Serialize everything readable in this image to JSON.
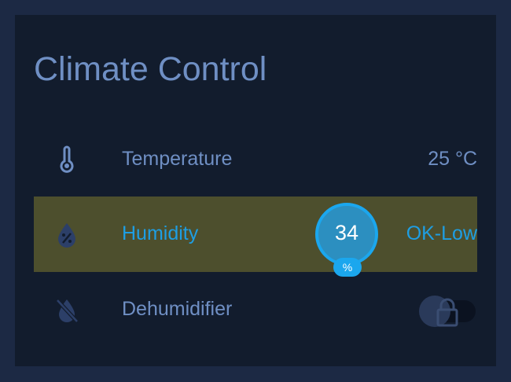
{
  "card": {
    "title": "Climate Control",
    "rows": [
      {
        "label": "Temperature",
        "value": "25 °C",
        "icon": "thermometer-icon"
      },
      {
        "label": "Humidity",
        "value": "OK-Low",
        "icon": "water-percent-icon",
        "badge": {
          "value": "34",
          "unit": "%"
        }
      },
      {
        "label": "Dehumidifier",
        "icon": "water-off-icon",
        "toggle": {
          "on": false,
          "locked": true
        }
      }
    ]
  },
  "colors": {
    "background": "#1c2944",
    "card": "#121c2d",
    "text": "#6f8fc4",
    "accent": "#1e9ee3",
    "highlight_row": "#4d4f2d"
  }
}
